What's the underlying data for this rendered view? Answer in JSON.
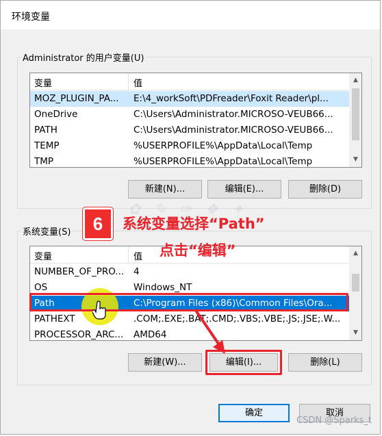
{
  "window": {
    "title": "环境变量"
  },
  "user_vars": {
    "group_label": "Administrator 的用户变量(U)",
    "columns": [
      "变量",
      "值"
    ],
    "rows": [
      {
        "name": "MOZ_PLUGIN_PA...",
        "value": "E:\\4_workSoft\\PDFreader\\Foxit Reader\\pl..."
      },
      {
        "name": "OneDrive",
        "value": "C:\\Users\\Administrator.MICROSO-VEUB66..."
      },
      {
        "name": "PATH",
        "value": "C:\\Users\\Administrator.MICROSO-VEUB66..."
      },
      {
        "name": "TEMP",
        "value": "%USERPROFILE%\\AppData\\Local\\Temp"
      },
      {
        "name": "TMP",
        "value": "%USERPROFILE%\\AppData\\Local\\Temp"
      }
    ],
    "buttons": {
      "new": "新建(N)...",
      "edit": "编辑(E)...",
      "delete": "删除(D)"
    }
  },
  "system_vars": {
    "group_label": "系统变量(S)",
    "columns": [
      "变量",
      "值"
    ],
    "rows": [
      {
        "name": "NUMBER_OF_PRO...",
        "value": "4"
      },
      {
        "name": "OS",
        "value": "Windows_NT"
      },
      {
        "name": "Path",
        "value": "C:\\Program Files (x86)\\Common Files\\Ora..."
      },
      {
        "name": "PATHEXT",
        "value": ".COM;.EXE;.BAT;.CMD;.VBS;.VBE;.JS;.JSE;.W..."
      },
      {
        "name": "PROCESSOR_ARC...",
        "value": "AMD64"
      }
    ],
    "selected_row": 2,
    "buttons": {
      "new": "新建(W)...",
      "edit": "编辑(I)...",
      "delete": "删除(L)"
    }
  },
  "dialog_buttons": {
    "ok": "确定",
    "cancel": "取消"
  },
  "annotation": {
    "step": "6",
    "line1": "系统变量选择“Path”",
    "line2": "点击“编辑”",
    "color": "#e8232b"
  },
  "watermark": "CSDN @Sparks_t",
  "colors": {
    "selection": "#0078d7",
    "annotation": "#e8232b"
  },
  "icons": [
    "chevron-up-icon",
    "chevron-down-icon",
    "hand-cursor-icon",
    "arrow-icon"
  ]
}
